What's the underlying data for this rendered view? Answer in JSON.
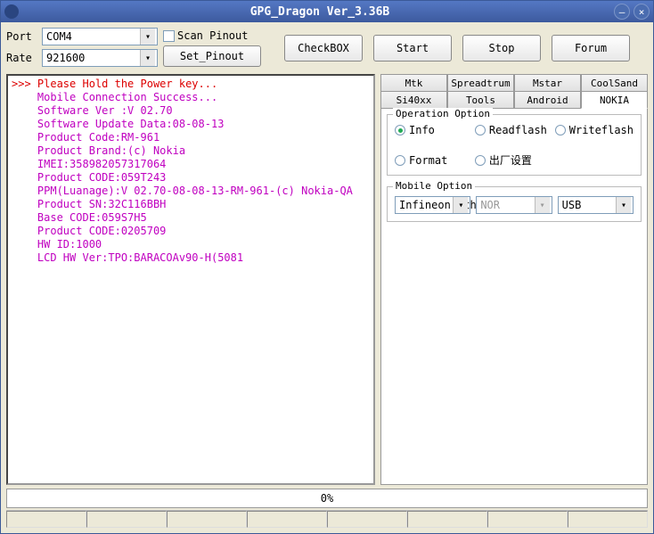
{
  "window": {
    "title": "GPG_Dragon  Ver_3.36B"
  },
  "port": {
    "port_label": "Port",
    "port_value": "COM4",
    "rate_label": "Rate",
    "rate_value": "921600"
  },
  "pinout": {
    "scan_label": "Scan Pinout",
    "set_label": "Set_Pinout"
  },
  "buttons": {
    "checkbox": "CheckBOX",
    "start": "Start",
    "stop": "Stop",
    "forum": "Forum"
  },
  "log": {
    "lines": [
      {
        "text": ">>> Please Hold the Power key...",
        "cls": "log-red"
      },
      {
        "text": "    Mobile Connection Success...",
        "cls": "log-mag"
      },
      {
        "text": "    Software Ver :V 02.70",
        "cls": "log-mag"
      },
      {
        "text": "    Software Update Data:08-08-13",
        "cls": "log-mag"
      },
      {
        "text": "    Product Code:RM-961",
        "cls": "log-mag"
      },
      {
        "text": "    Product Brand:(c) Nokia",
        "cls": "log-mag"
      },
      {
        "text": "    IMEI:358982057317064",
        "cls": "log-mag"
      },
      {
        "text": "    Product CODE:059T243",
        "cls": "log-mag"
      },
      {
        "text": "    PPM(Luanage):V 02.70-08-08-13-RM-961-(c) Nokia-QA",
        "cls": "log-mag"
      },
      {
        "text": "    Product SN:32C116BBH",
        "cls": "log-mag"
      },
      {
        "text": "    Base CODE:059S7H5",
        "cls": "log-mag"
      },
      {
        "text": "    Product CODE:0205709",
        "cls": "log-mag"
      },
      {
        "text": "    HW ID:1000",
        "cls": "log-mag"
      },
      {
        "text": "    LCD HW Ver:TPO:BARACOAv90-H(5081",
        "cls": "log-mag"
      }
    ]
  },
  "tabs": {
    "row1": [
      "Mtk",
      "Spreadtrum",
      "Mstar",
      "CoolSand"
    ],
    "row2": [
      "Si40xx",
      "Tools",
      "Android",
      "NOKIA"
    ],
    "active": "NOKIA"
  },
  "operation": {
    "legend": "Operation Option",
    "options": [
      {
        "label": "Info",
        "checked": true
      },
      {
        "label": "Readflash",
        "checked": false
      },
      {
        "label": "Writeflash",
        "checked": false
      },
      {
        "label": "Format",
        "checked": false
      },
      {
        "label": "出厂设置",
        "checked": false
      }
    ]
  },
  "mobile": {
    "legend": "Mobile Option",
    "chip": "Infineon(Others)",
    "mode": "NOR",
    "conn": "USB"
  },
  "progress": {
    "text": "0%"
  }
}
